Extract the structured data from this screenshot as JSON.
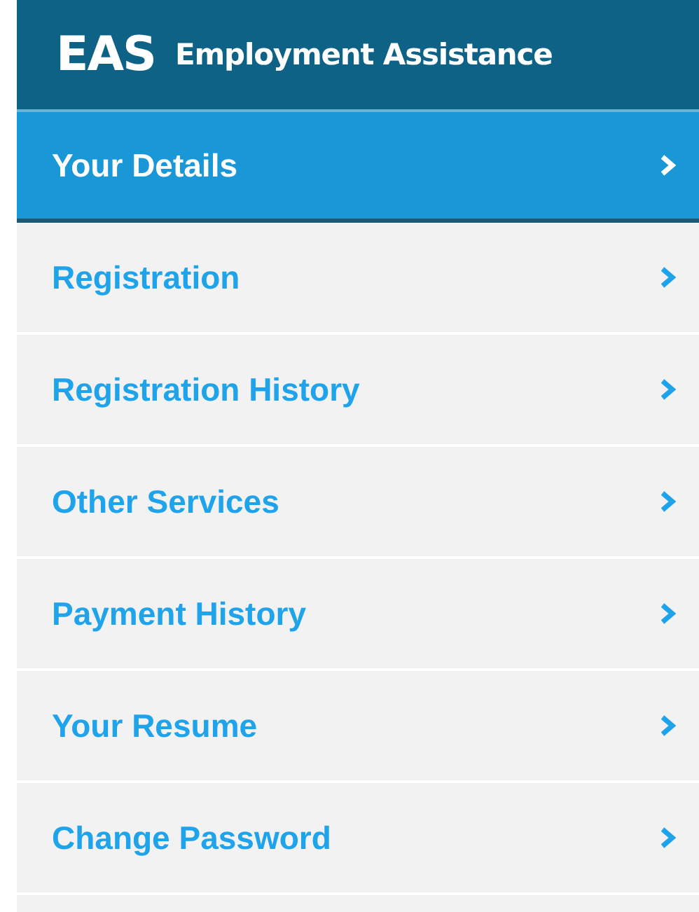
{
  "header": {
    "logo": "EAS",
    "title": "Employment Assistance"
  },
  "menu": [
    {
      "label": "Your Details",
      "selected": true
    },
    {
      "label": "Registration",
      "selected": false
    },
    {
      "label": "Registration History",
      "selected": false
    },
    {
      "label": "Other Services",
      "selected": false
    },
    {
      "label": "Payment History",
      "selected": false
    },
    {
      "label": "Your Resume",
      "selected": false
    },
    {
      "label": "Change Password",
      "selected": false
    }
  ]
}
